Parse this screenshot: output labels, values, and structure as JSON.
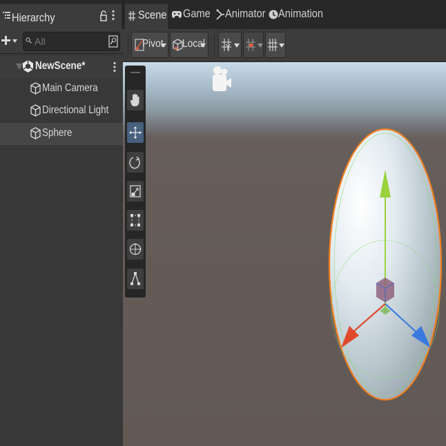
{
  "hierarchy": {
    "tab_label": "Hierarchy",
    "search_placeholder": "All",
    "scene_name": "NewScene*",
    "items": [
      {
        "label": "Main Camera",
        "selected": false
      },
      {
        "label": "Directional Light",
        "selected": false
      },
      {
        "label": "Sphere",
        "selected": true
      }
    ]
  },
  "scene_view": {
    "tabs": [
      {
        "label": "Scene",
        "icon": "hash-icon",
        "active": true
      },
      {
        "label": "Game",
        "icon": "gamepad-icon",
        "active": false
      },
      {
        "label": "Animator",
        "icon": "animator-icon",
        "active": false
      },
      {
        "label": "Animation",
        "icon": "clock-icon",
        "active": false
      }
    ],
    "toolbar": {
      "pivot_label": "Pivot",
      "local_label": "Local"
    },
    "tools": [
      "hand-tool",
      "move-tool",
      "rotate-tool",
      "scale-tool",
      "rect-tool",
      "transform-tool",
      "custom-tool"
    ],
    "active_tool": "move-tool"
  },
  "colors": {
    "panel": "#383838",
    "selection": "#464646",
    "active_tool": "#46607e",
    "outline": "#f08020",
    "axis_x": "#e04a2c",
    "axis_y": "#9ad23c",
    "axis_z": "#3a7ae0"
  }
}
